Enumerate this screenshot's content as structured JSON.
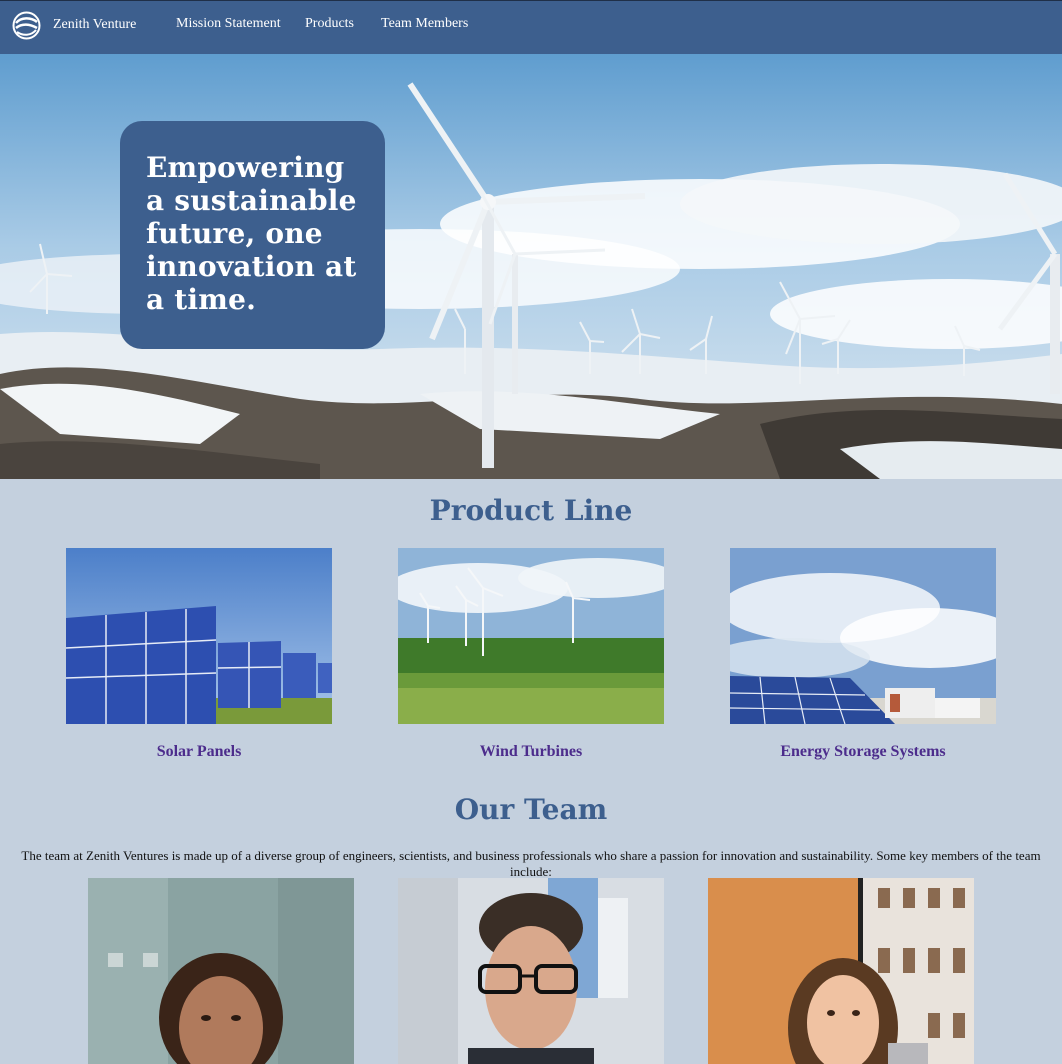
{
  "nav": {
    "logo_icon": "globe-swirl-icon",
    "brand": "Zenith Venture",
    "links": [
      "Mission Statement",
      "Products",
      "Team Members"
    ]
  },
  "hero": {
    "tagline": "Empowering a sustainable future, one innovation at a time.",
    "image": "wind-turbines-snowy-hills-photo"
  },
  "products": {
    "title": "Product Line",
    "items": [
      {
        "label": "Solar Panels",
        "image": "solar-panels-photo"
      },
      {
        "label": "Wind Turbines",
        "image": "wind-turbines-field-photo"
      },
      {
        "label": "Energy Storage Systems",
        "image": "energy-storage-photo"
      }
    ]
  },
  "team": {
    "title": "Our Team",
    "intro": "The team at Zenith Ventures is made up of a diverse group of engineers, scientists, and business professionals who share a passion for innovation and sustainability. Some key members of the team include:",
    "members": [
      {
        "image": "team-member-woman-curly-hair-photo"
      },
      {
        "image": "team-member-man-glasses-photo"
      },
      {
        "image": "team-member-woman-long-hair-photo"
      }
    ]
  },
  "colors": {
    "nav_bg": "#3d5f8e",
    "page_bg": "#c4d0de",
    "accent_title": "#3d5f8e",
    "product_label": "#4c2c8c"
  }
}
